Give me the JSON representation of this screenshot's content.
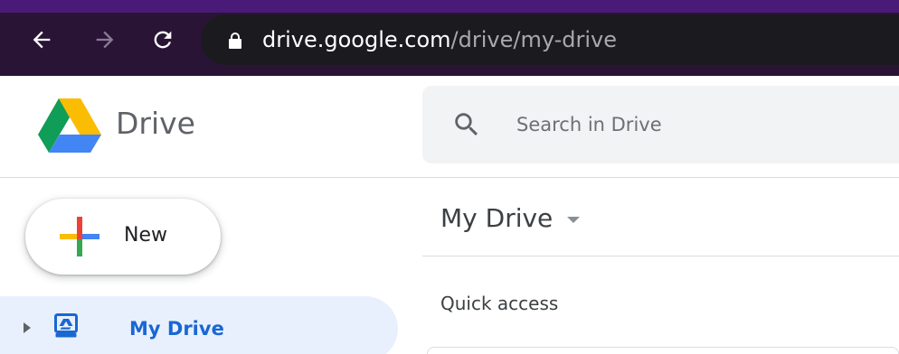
{
  "browser": {
    "url_domain": "drive.google.com",
    "url_path": "/drive/my-drive"
  },
  "app": {
    "brand": "Drive"
  },
  "search": {
    "placeholder": "Search in Drive"
  },
  "sidebar": {
    "new_label": "New",
    "items": [
      {
        "label": "My Drive"
      }
    ]
  },
  "main": {
    "title": "My Drive",
    "section": "Quick access"
  },
  "colors": {
    "browser_bar": "#2a1436",
    "accent_blue": "#1967d2",
    "selected_bg": "#e8f0fe"
  }
}
